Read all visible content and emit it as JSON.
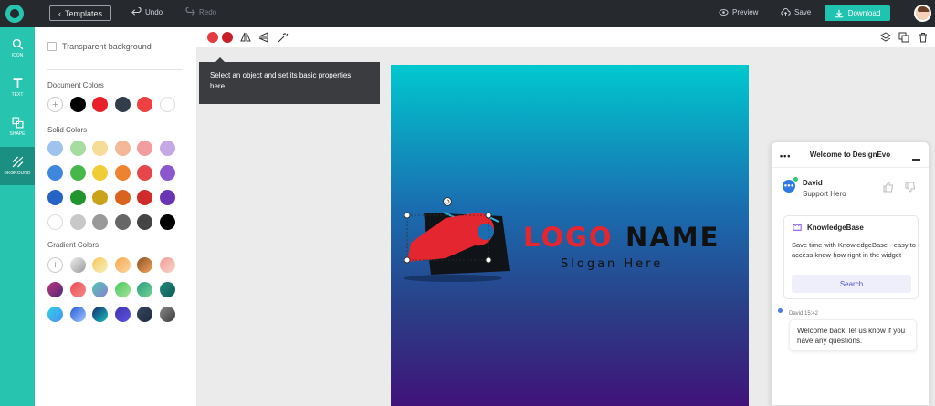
{
  "topbar": {
    "templates_label": "Templates",
    "undo_label": "Undo",
    "redo_label": "Redo",
    "preview_label": "Preview",
    "save_label": "Save",
    "download_label": "Download"
  },
  "rail": {
    "items": [
      {
        "label": "ICON",
        "icon": "search-icon"
      },
      {
        "label": "TEXT",
        "icon": "text-icon"
      },
      {
        "label": "SHAPE",
        "icon": "shape-icon"
      },
      {
        "label": "BKGROUND",
        "icon": "background-icon"
      }
    ]
  },
  "panel": {
    "transparent_label": "Transparent background",
    "document_colors_title": "Document Colors",
    "document_colors": [
      "#000000",
      "#e8202a",
      "#333c4a",
      "#ee4040",
      "#ffffff"
    ],
    "solid_colors_title": "Solid Colors",
    "solid_colors": [
      "#9ec3ef",
      "#a6dca0",
      "#f7dc98",
      "#f2b897",
      "#f39da1",
      "#c4a9e6",
      "#3f86de",
      "#46b84a",
      "#f0cd37",
      "#ed8330",
      "#e6474a",
      "#8a58cc",
      "#2563c5",
      "#23952f",
      "#caa31b",
      "#d9641f",
      "#d02b2b",
      "#6a35b5",
      "#ffffff",
      "#c8c8c8",
      "#999999",
      "#666666",
      "#444444",
      "#000000"
    ],
    "gradient_colors_title": "Gradient Colors",
    "gradient_colors": [
      [
        "#eeeeee",
        "#9a9a9a"
      ],
      [
        "#f7c95d",
        "#f6f0bd"
      ],
      [
        "#f7a84d",
        "#fbd6a0"
      ],
      [
        "#8a5024",
        "#f4a35a"
      ],
      [
        "#f49a9a",
        "#f8d7c7"
      ],
      [
        "#c0357a",
        "#4a2a79"
      ],
      [
        "#ec4a57",
        "#f48d87"
      ],
      [
        "#4fc7ae",
        "#8a7fd8"
      ],
      [
        "#48c95f",
        "#a6e09a"
      ],
      [
        "#2c9e8a",
        "#72d38b"
      ],
      [
        "#23877a",
        "#0e5d57"
      ],
      [
        "#2dd3e8",
        "#4b8df2"
      ],
      [
        "#1f5bd8",
        "#a9c7ff"
      ],
      [
        "#182b70",
        "#18c0c2"
      ],
      [
        "#4232b2",
        "#5b53de"
      ],
      [
        "#38465e",
        "#1d2a3d"
      ],
      [
        "#8b8b8b",
        "#3a3a3a"
      ]
    ]
  },
  "toolbar": {
    "colors": [
      "#e53a41",
      "#c71f27"
    ]
  },
  "tooltip": {
    "text": "Select an object and set its basic properties here."
  },
  "logo": {
    "name_part1": "LOGO",
    "name_part2": "NAME",
    "slogan": "Slogan Here",
    "colors": {
      "red": "#e3262f",
      "dark": "#111111"
    }
  },
  "chat": {
    "title": "Welcome to DesignEvo",
    "agent_name": "David",
    "agent_role": "Support Hero",
    "kb_title": "KnowledgeBase",
    "kb_text": "Save time with KnowledgeBase - easy to access know-how right in the widget",
    "kb_search": "Search",
    "msg_meta": "David 15:42",
    "msg_text": "Welcome back, let us know if you have any questions."
  }
}
